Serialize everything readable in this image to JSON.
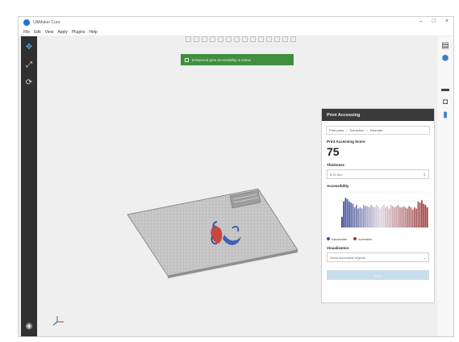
{
  "window": {
    "title": "UltiMaker Cura"
  },
  "menu": [
    "File",
    "Edit",
    "View",
    "Apply",
    "Plugins",
    "Help"
  ],
  "notification": {
    "text": "Enhanced print accessibility is active"
  },
  "panel": {
    "title": "Print Accessing",
    "breadcrumbs": [
      "Print parts",
      "Extraction",
      "Estimate"
    ],
    "score_label": "Print Accessing Score",
    "score": "75",
    "field_label": "Thickness",
    "field_value": "0.20 mm",
    "chart_label": "Accessibility",
    "legend": [
      "Inaccessible",
      "Accessible"
    ],
    "select_label": "Visualization",
    "select_value": "Show accessible regions",
    "apply_label": "Apply"
  },
  "colors": {
    "accent": "#1e6fd9",
    "bar_blue": "#3a4f99",
    "bar_red": "#9a3b3b",
    "notify": "#3f8f3f",
    "panel_head": "#3a3a3a"
  },
  "icons": {
    "left": [
      "move-tool-icon",
      "scale-tool-icon",
      "rotate-tool-icon",
      "support-icon"
    ],
    "right": [
      "settings-icon",
      "material-icon",
      "printer-icon",
      "camera-icon",
      "chart-icon"
    ]
  },
  "chart_data": {
    "type": "bar",
    "values": [
      9,
      22,
      25,
      24,
      22,
      21,
      20,
      17,
      19,
      16,
      17,
      16,
      19,
      18,
      18,
      17,
      19,
      18,
      17,
      19,
      18,
      16,
      18,
      19,
      17,
      18,
      16,
      19,
      18,
      17,
      18,
      19,
      17,
      17,
      18,
      17,
      16,
      18,
      17,
      15,
      17,
      16,
      22,
      21,
      23,
      20,
      19,
      17
    ],
    "ylim": [
      0,
      30
    ],
    "split_index": 21
  }
}
